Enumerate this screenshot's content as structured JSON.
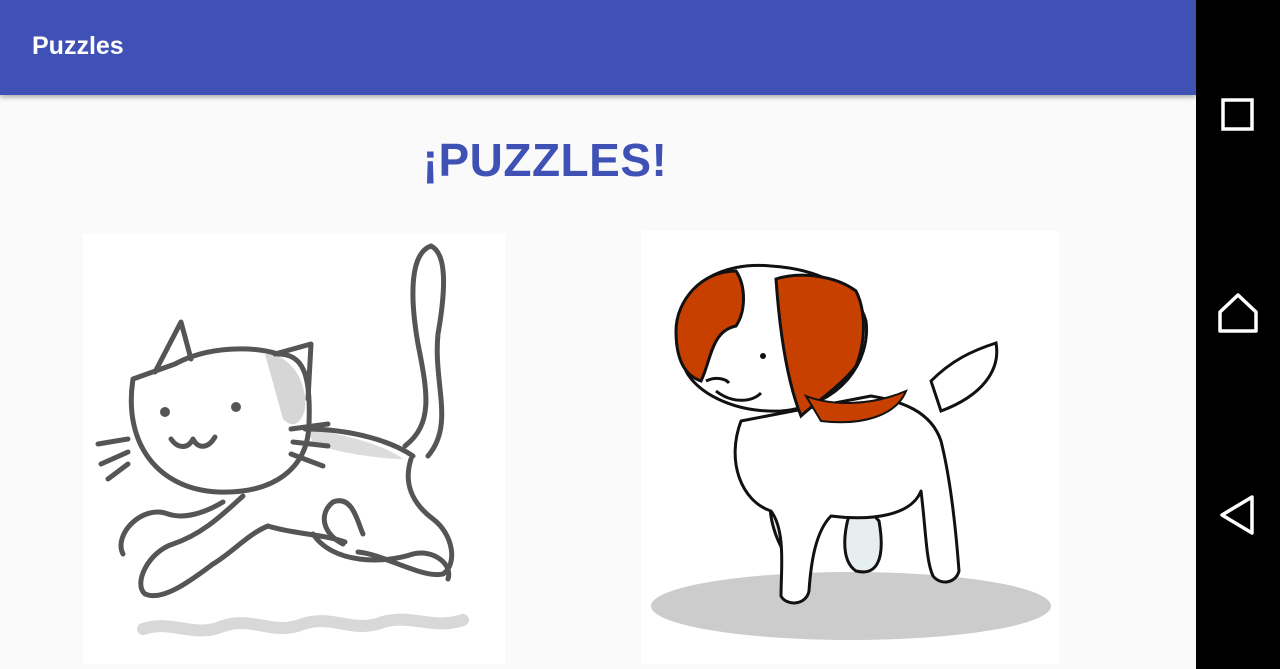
{
  "appbar": {
    "title": "Puzzles",
    "color": "#3f51b5"
  },
  "main": {
    "heading": "¡PUZZLES!",
    "puzzles": [
      {
        "id": "cat",
        "icon": "cat-illustration"
      },
      {
        "id": "dog",
        "icon": "dog-illustration"
      }
    ]
  },
  "navbar": {
    "buttons": [
      {
        "icon": "recent-apps-icon"
      },
      {
        "icon": "home-icon"
      },
      {
        "icon": "back-icon"
      }
    ]
  }
}
